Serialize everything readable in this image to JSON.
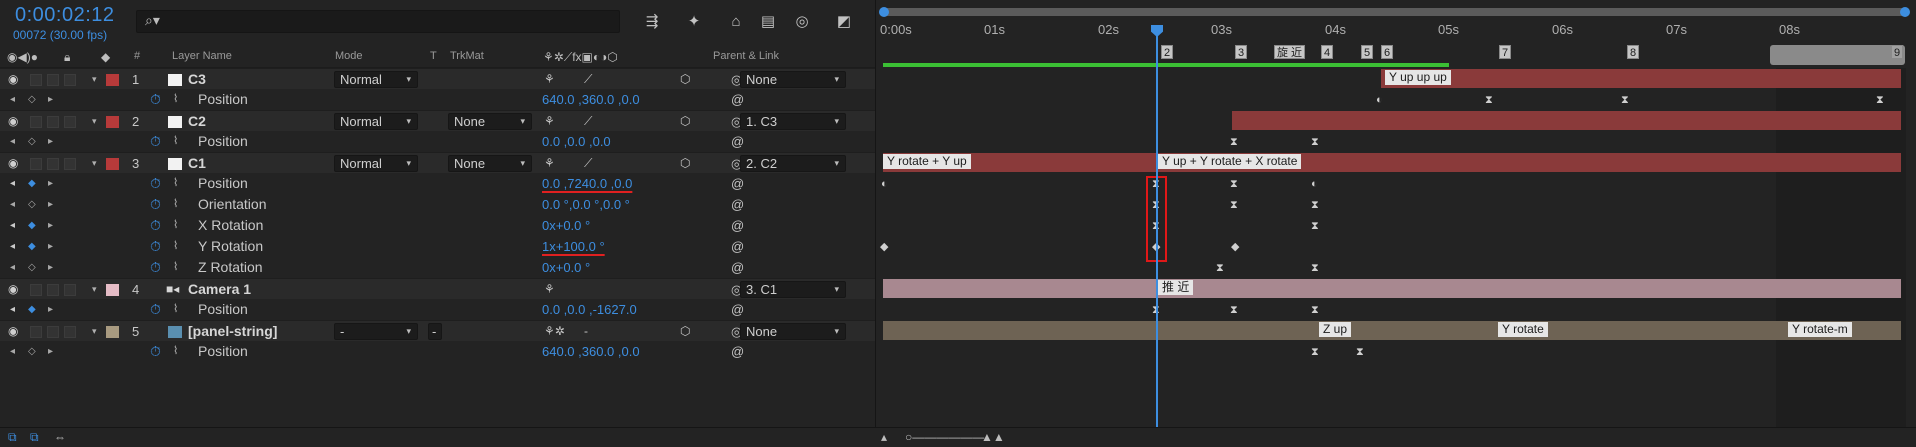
{
  "header": {
    "timecode": "0:00:02:12",
    "frame_info": "00072 (30.00 fps)",
    "search_placeholder": ""
  },
  "columns": {
    "layer_name": "Layer Name",
    "mode": "Mode",
    "trkmat": "TrkMat",
    "parent_link": "Parent & Link",
    "num": "#",
    "t": "T"
  },
  "layers": [
    {
      "index": "1",
      "name": "C3",
      "color": "#b73a3a",
      "mode": "Normal",
      "trkmat": "",
      "parent": "None",
      "props": [
        {
          "name": "Position",
          "value": "640.0 ,360.0 ,0.0"
        }
      ]
    },
    {
      "index": "2",
      "name": "C2",
      "color": "#b73a3a",
      "mode": "Normal",
      "trkmat": "None",
      "parent": "1. C3",
      "props": [
        {
          "name": "Position",
          "value": "0.0 ,0.0 ,0.0"
        }
      ]
    },
    {
      "index": "3",
      "name": "C1",
      "color": "#b73a3a",
      "mode": "Normal",
      "trkmat": "None",
      "parent": "2. C2",
      "props": [
        {
          "name": "Position",
          "value": "0.0 ,7240.0 ,0.0"
        },
        {
          "name": "Orientation",
          "value": "0.0 °,0.0 °,0.0 °"
        },
        {
          "name": "X Rotation",
          "value": "0x+0.0 °"
        },
        {
          "name": "Y Rotation",
          "value": "1x+100.0 °"
        },
        {
          "name": "Z Rotation",
          "value": "0x+0.0 °"
        }
      ]
    },
    {
      "index": "4",
      "name": "Camera 1",
      "color": "#e5bcc6",
      "mode": "",
      "trkmat": "",
      "parent": "3. C1",
      "props": [
        {
          "name": "Position",
          "value": "0.0 ,0.0 ,-1627.0"
        }
      ]
    },
    {
      "index": "5",
      "name": "[panel-string]",
      "color": "#a89a80",
      "mode": "-",
      "trkmat": "-",
      "parent": "None",
      "props": [
        {
          "name": "Position",
          "value": "640.0 ,360.0 ,0.0"
        }
      ]
    }
  ],
  "timeline": {
    "ruler": [
      "0:00s",
      "01s",
      "02s",
      "03s",
      "04s",
      "05s",
      "06s",
      "07s",
      "08s"
    ],
    "markers": [
      "2",
      "3",
      "旋 近",
      "4",
      "5",
      "6",
      "7",
      "8",
      "9"
    ],
    "bar_labels": {
      "c3": "Y up up up",
      "c1_a": "Y rotate + Y up",
      "c1_b": "Y up + Y rotate + X rotate",
      "camera": "推 近",
      "panel_a": "Z up",
      "panel_b": "Y rotate",
      "panel_c": "Y rotate-m"
    }
  },
  "colors": {
    "accent": "#3d8ee0",
    "layer_red": "#b73a3a",
    "bar_red": "#8a3a3a",
    "bar_pink": "#a88890",
    "bar_tan": "#6e6354",
    "work_area": "#3bbf34",
    "highlight": "#e01818"
  }
}
